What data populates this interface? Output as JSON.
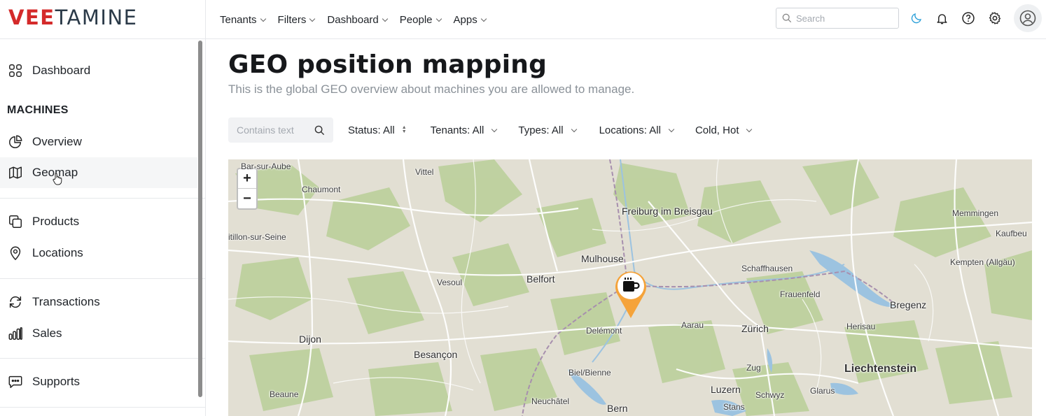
{
  "brand": {
    "prefix": "VEE",
    "suffix": "TAMINE"
  },
  "topnav": {
    "items": [
      {
        "label": "Tenants"
      },
      {
        "label": "Filters"
      },
      {
        "label": "Dashboard"
      },
      {
        "label": "People"
      },
      {
        "label": "Apps"
      }
    ],
    "search_placeholder": "Search",
    "icons": [
      "moon-icon",
      "bell-icon",
      "help-icon",
      "gear-icon",
      "user-avatar-icon"
    ],
    "accent_color": "#2a9fd8"
  },
  "sidebar": {
    "dashboard": "Dashboard",
    "section_machines": "MACHINES",
    "overview": "Overview",
    "geomap": "Geomap",
    "products": "Products",
    "locations": "Locations",
    "transactions": "Transactions",
    "sales": "Sales",
    "supports": "Supports",
    "active_item": "Geomap"
  },
  "page": {
    "title": "GEO position mapping",
    "subtitle": "This is the global GEO overview about machines you are allowed to manage."
  },
  "filters": {
    "text_placeholder": "Contains text",
    "status": "Status: All",
    "tenants": "Tenants: All",
    "types": "Types: All",
    "locations": "Locations: All",
    "temperature": "Cold, Hot"
  },
  "map": {
    "zoom_in": "+",
    "zoom_out": "−",
    "marker": {
      "icon": "coffee-cup-icon",
      "color": "#f5a33a"
    },
    "places": {
      "bar_sur_aube": "Bar-sur-Aube",
      "vittel": "Vittel",
      "chaumont": "Chaumont",
      "freiburg": "Freiburg im Breisgau",
      "memmingen": "Memmingen",
      "kaufbeu": "Kaufbeu",
      "chatillon": "itillon-sur-Seine",
      "mulhouse": "Mulhouse",
      "schaffhausen": "Schaffhausen",
      "kempten": "Kempten (Allgäu)",
      "belfort": "Belfort",
      "vesoul": "Vesoul",
      "frauenfeld": "Frauenfeld",
      "bregenz": "Bregenz",
      "delemont": "Delémont",
      "aarau": "Aarau",
      "zurich": "Zürich",
      "herisau": "Herisau",
      "dijon": "Dijon",
      "besancon": "Besançon",
      "liechtenstein": "Liechtenstein",
      "zug": "Zug",
      "biel": "Biel/Bienne",
      "luzern": "Luzern",
      "beaune": "Beaune",
      "schwyz": "Schwyz",
      "glarus": "Glarus",
      "neuchatel": "Neuchâtel",
      "bern": "Bern",
      "stans": "Stans"
    }
  }
}
